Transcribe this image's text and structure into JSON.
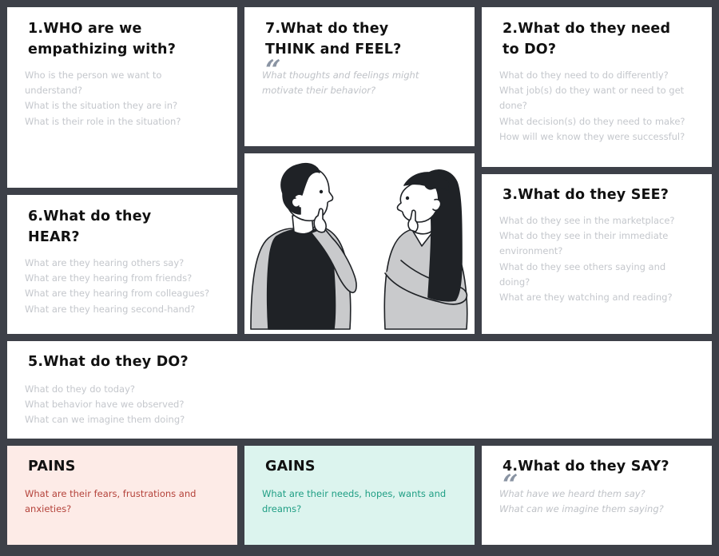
{
  "cards": {
    "who": {
      "title": "1.WHO are we\nempathizing with?",
      "lines": [
        "Who is the person we want to",
        "understand?",
        "What is the situation they are in?",
        "What is their role in the situation?"
      ]
    },
    "think": {
      "title": "7.What do they\nTHINK and FEEL?",
      "quote_icon": "quote-mark-icon",
      "lines": [
        "What thoughts and feelings might",
        "motivate their behavior?"
      ]
    },
    "need": {
      "title": "2.What do they need\nto DO?",
      "lines": [
        "What do they need to do differently?",
        "What job(s) do they want or need to get",
        "done?",
        "What decision(s) do they need to make?",
        "How will we know they were successful?"
      ]
    },
    "hear": {
      "title": "6.What do they\nHEAR?",
      "lines": [
        "What are they hearing others say?",
        "What are they hearing from friends?",
        "What are they hearing  from colleagues?",
        "What are they hearing second-hand?"
      ]
    },
    "see": {
      "title": "3.What do they SEE?",
      "lines": [
        "What do they see in the marketplace?",
        "What do they see in their immediate",
        "environment?",
        "What do they see others saying and",
        "doing?",
        "What are they watching and reading?"
      ]
    },
    "do": {
      "title": "5.What do they DO?",
      "lines": [
        "What do they do today?",
        "What behavior have we observed?",
        "What can we imagine them doing?"
      ]
    },
    "pains": {
      "title": "PAINS",
      "lines": [
        "What are their fears, frustrations and",
        "anxieties?"
      ],
      "color": "#b4423a",
      "background": "#fdebe7"
    },
    "gains": {
      "title": "GAINS",
      "lines": [
        "What are their needs, hopes, wants and",
        "dreams?"
      ],
      "color": "#1f9e84",
      "background": "#dcf4ee"
    },
    "say": {
      "title": "4.What do they SAY?",
      "quote_icon": "quote-mark-icon",
      "lines": [
        "What have we heard them say?",
        "What can we imagine them saying?"
      ]
    }
  },
  "illustration": "two-people-thinking-illustration",
  "colors": {
    "background": "#3d4048",
    "card": "#ffffff",
    "hair": "#1f2226",
    "skin": "#ffffff",
    "shirt": "#c9cacc"
  }
}
